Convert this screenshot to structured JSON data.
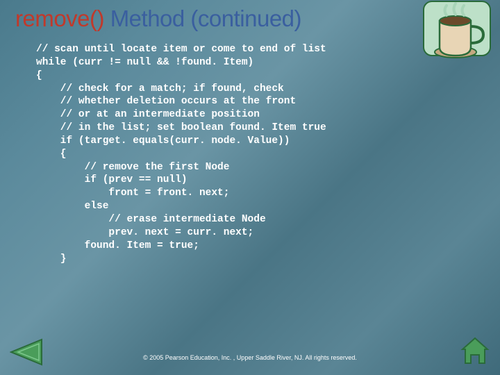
{
  "title_part1": "remove() ",
  "title_part2": "Method (continued)",
  "code": "// scan until locate item or come to end of list\nwhile (curr != null && !found. Item)\n{\n    // check for a match; if found, check\n    // whether deletion occurs at the front\n    // or at an intermediate position\n    // in the list; set boolean found. Item true\n    if (target. equals(curr. node. Value))\n    {\n        // remove the first Node\n        if (prev == null)\n            front = front. next;\n        else\n            // erase intermediate Node\n            prev. next = curr. next;\n        found. Item = true;\n    }",
  "copyright": "© 2005 Pearson Education, Inc. , Upper Saddle River, NJ.  All rights reserved."
}
